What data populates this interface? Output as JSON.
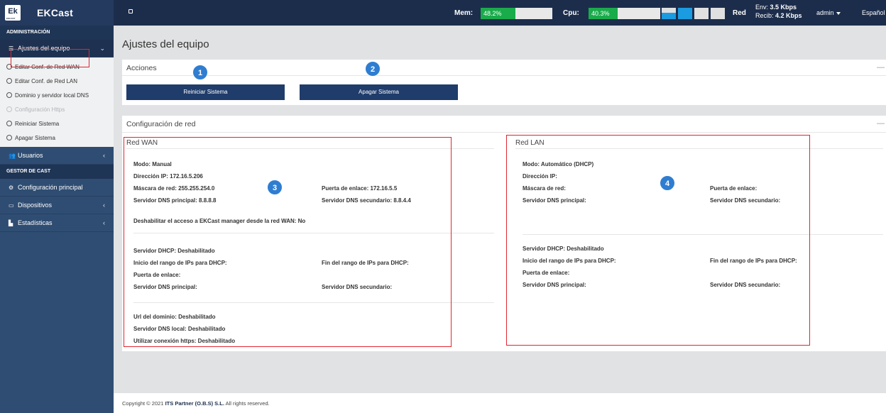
{
  "header": {
    "logo_text": "Ek",
    "logo_subtext": "EKCAST",
    "app_title": "EKCast",
    "mem_label": "Mem:",
    "mem_value": "48.2%",
    "mem_fraction": 0.482,
    "cpu_label": "Cpu:",
    "cpu_value": "40.3%",
    "cpu_fraction": 0.403,
    "red_label": "Red",
    "env_label": "Env:",
    "env_value": "3.5 Kbps",
    "recib_label": "Recib:",
    "recib_value": "4.2 Kbps",
    "user": "admin",
    "language": "Español"
  },
  "sidebar": {
    "section_admin": "ADMINISTRACIÓN",
    "ajustes_label": "Ajustes del equipo",
    "sub_items": [
      {
        "label": "Editar Conf. de Red WAN",
        "disabled": false
      },
      {
        "label": "Editar Conf. de Red LAN",
        "disabled": false
      },
      {
        "label": "Dominio y servidor local DNS",
        "disabled": false
      },
      {
        "label": "Configuración Https",
        "disabled": true
      },
      {
        "label": "Reiniciar Sistema",
        "disabled": false
      },
      {
        "label": "Apagar Sistema",
        "disabled": false
      }
    ],
    "usuarios_label": "Usuarios",
    "section_cast": "GESTOR DE CAST",
    "config_principal_label": "Configuración principal",
    "dispositivos_label": "Dispositivos",
    "estadisticas_label": "Estadísticas"
  },
  "main": {
    "page_title": "Ajustes del equipo",
    "acciones_title": "Acciones",
    "reiniciar_button": "Reiniciar Sistema",
    "apagar_button": "Apagar Sistema",
    "badges": [
      "1",
      "2",
      "3",
      "4"
    ],
    "config_red_title": "Configuración de red",
    "wan": {
      "title": "Red WAN",
      "modo": "Modo: Manual",
      "ip": "Dirección IP: 172.16.5.206",
      "mascara": "Máscara de red: 255.255.254.0",
      "puerta": "Puerta de enlace: 172.16.5.5",
      "dns1": "Servidor DNS principal: 8.8.8.8",
      "dns2": "Servidor DNS secundario: 8.8.4.4",
      "deshabilitar": "Deshabilitar el acceso a EKCast manager desde la red WAN: No",
      "dhcp": "Servidor DHCP: Deshabilitado",
      "inicio_rango": "Inicio del rango de IPs para DHCP:",
      "fin_rango": "Fin del rango de IPs para DHCP:",
      "dhcp_puerta": "Puerta de enlace:",
      "dhcp_dns1": "Servidor DNS principal:",
      "dhcp_dns2": "Servidor DNS secundario:",
      "url_dominio": "Url del dominio: Deshabilitado",
      "dns_local": "Servidor DNS local: Deshabilitado",
      "https": "Utilizar conexión https: Deshabilitado"
    },
    "lan": {
      "title": "Red LAN",
      "modo": "Modo: Automático (DHCP)",
      "ip": "Dirección IP:",
      "mascara": "Máscara de red:",
      "puerta": "Puerta de enlace:",
      "dns1": "Servidor DNS principal:",
      "dns2": "Servidor DNS secundario:",
      "dhcp": "Servidor DHCP: Deshabilitado",
      "inicio_rango": "Inicio del rango de IPs para DHCP:",
      "fin_rango": "Fin del rango de IPs para DHCP:",
      "dhcp_puerta": "Puerta de enlace:",
      "dhcp_dns1": "Servidor DNS principal:",
      "dhcp_dns2": "Servidor DNS secundario:"
    }
  },
  "footer": {
    "prefix": "Copyright © 2021",
    "company": "ITS Partner (O.B.S) S.L.",
    "suffix": "All rights reserved."
  },
  "colors": {
    "header_bg": "#1c2d4c",
    "sidebar_bg": "#2f4d72",
    "button_bg": "#1f3c6a",
    "meter_green": "#1aab4b",
    "network_blue": "#1b9be0",
    "highlight_red": "#e0262f",
    "badge_blue": "#2f7dd1"
  }
}
